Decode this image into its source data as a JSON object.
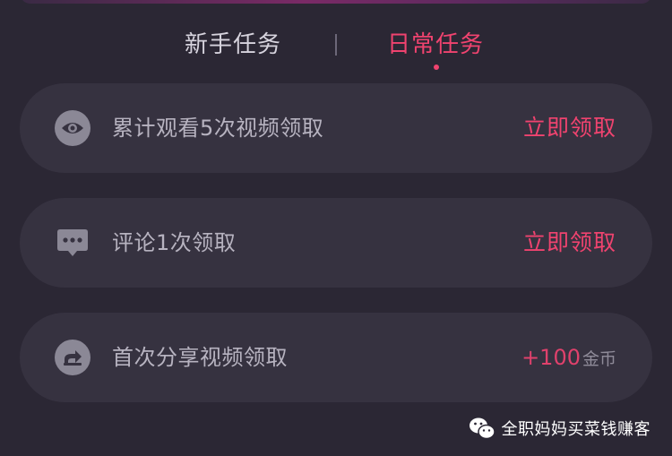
{
  "tabs": [
    {
      "label": "新手任务",
      "active": false
    },
    {
      "label": "日常任务",
      "active": true
    }
  ],
  "tasks": [
    {
      "icon": "eye-icon",
      "label": "累计观看5次视频领取",
      "action": "立即领取"
    },
    {
      "icon": "comment-icon",
      "label": "评论1次领取",
      "action": "立即领取"
    },
    {
      "icon": "share-icon",
      "label": "首次分享视频领取",
      "reward_amount": "+100",
      "reward_unit": "金币"
    }
  ],
  "watermark": {
    "icon": "wechat-icon",
    "text": "全职妈妈买菜钱赚客"
  },
  "colors": {
    "background": "#2b2734",
    "card": "#363240",
    "accent": "#f0436f",
    "muted_text": "#b7b3c0"
  }
}
